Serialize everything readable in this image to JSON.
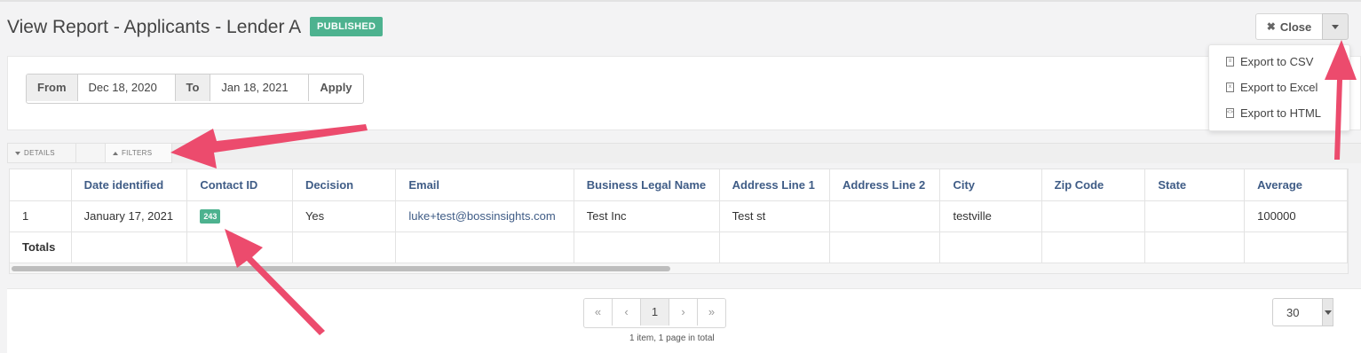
{
  "header": {
    "title": "View Report - Applicants - Lender A",
    "status_badge": "PUBLISHED",
    "close_label": "Close"
  },
  "export_menu": {
    "items": [
      {
        "label": "Export to CSV",
        "icon": "document-icon"
      },
      {
        "label": "Export to Excel",
        "icon": "excel-file-icon"
      },
      {
        "label": "Export to HTML",
        "icon": "code-file-icon"
      }
    ]
  },
  "date_filter": {
    "from_label": "From",
    "from_value": "Dec 18, 2020",
    "to_label": "To",
    "to_value": "Jan 18, 2021",
    "apply_label": "Apply"
  },
  "tabs": {
    "details": "DETAILS",
    "filters": "FILTERS"
  },
  "table": {
    "columns": [
      "",
      "Date identified",
      "Contact ID",
      "Decision",
      "Email",
      "Business Legal Name",
      "Address Line 1",
      "Address Line 2",
      "City",
      "Zip Code",
      "State",
      "Average"
    ],
    "rows": [
      {
        "index": "1",
        "date_identified": "January 17, 2021",
        "contact_id": "243",
        "decision": "Yes",
        "email": "luke+test@bossinsights.com",
        "business_legal_name": "Test Inc",
        "address_line_1": "Test st",
        "address_line_2": "",
        "city": "testville",
        "zip_code": "",
        "state": "",
        "average": "100000"
      }
    ],
    "totals_label": "Totals"
  },
  "pagination": {
    "first": "«",
    "prev": "‹",
    "current": "1",
    "next": "›",
    "last": "»",
    "info": "1 item, 1 page in total",
    "per_page": "30"
  },
  "colors": {
    "badge_green": "#4db28f",
    "header_text_blue": "#3f5c86",
    "annotation_arrow": "#ec4b6d"
  }
}
